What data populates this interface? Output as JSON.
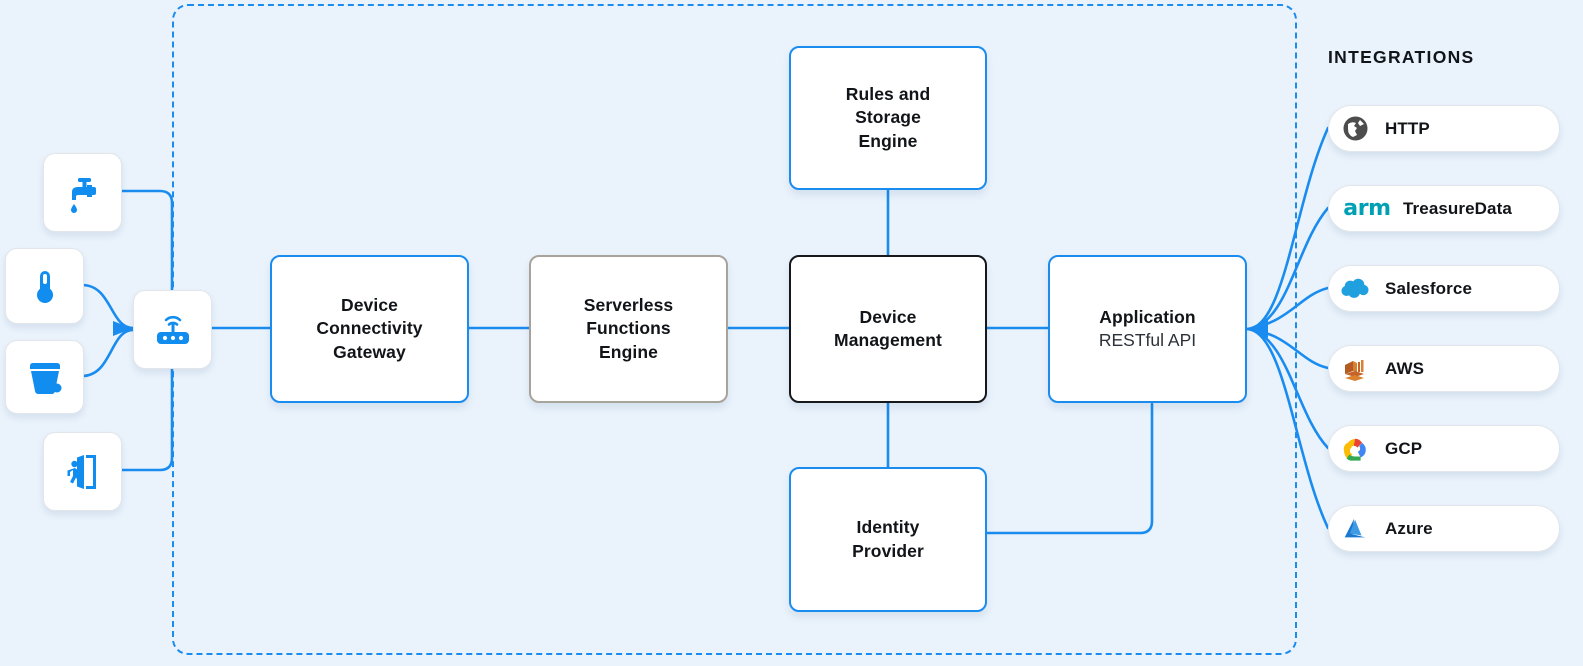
{
  "canvas": {
    "background": "#eaf3fc",
    "accent": "#1a8cf0",
    "platform_border": "#1a8cf0"
  },
  "devices": [
    {
      "name": "faucet-device",
      "icon": "faucet-icon"
    },
    {
      "name": "thermometer-device",
      "icon": "thermometer-icon"
    },
    {
      "name": "waste-bin-device",
      "icon": "trash-bin-icon"
    },
    {
      "name": "door-sensor-device",
      "icon": "exit-door-icon"
    }
  ],
  "gateway": {
    "name": "wireless-router",
    "icon": "router-icon"
  },
  "nodes": {
    "rules_storage": {
      "title": "Rules and\nStorage\nEngine",
      "lines": [
        "Rules and",
        "Storage",
        "Engine"
      ],
      "border": "#1a8cf0"
    },
    "device_connectivity": {
      "lines": [
        "Device",
        "Connectivity",
        "Gateway"
      ],
      "border": "#1a8cf0"
    },
    "serverless": {
      "lines": [
        "Serverless",
        "Functions",
        "Engine"
      ],
      "border": "#a8a49c"
    },
    "device_management": {
      "lines": [
        "Device",
        "Management"
      ],
      "border": "#16181b"
    },
    "application": {
      "title": "Application",
      "subtitle": "RESTful API",
      "border": "#1a8cf0"
    },
    "identity_provider": {
      "lines": [
        "Identity",
        "Provider"
      ],
      "border": "#1a8cf0"
    }
  },
  "integrations": {
    "heading": "INTEGRATIONS",
    "items": [
      {
        "label": "HTTP",
        "icon": "globe-icon",
        "color": "#4d4d4d"
      },
      {
        "label": "TreasureData",
        "icon": "arm-logo-icon",
        "color": "#00a0b4",
        "logo_text": "arm"
      },
      {
        "label": "Salesforce",
        "icon": "salesforce-cloud-icon",
        "color": "#20a0df"
      },
      {
        "label": "AWS",
        "icon": "aws-icon",
        "color": "#c4632a"
      },
      {
        "label": "GCP",
        "icon": "google-cloud-icon",
        "color": "#4285f4"
      },
      {
        "label": "Azure",
        "icon": "azure-icon",
        "color": "#1b78d0"
      }
    ]
  }
}
